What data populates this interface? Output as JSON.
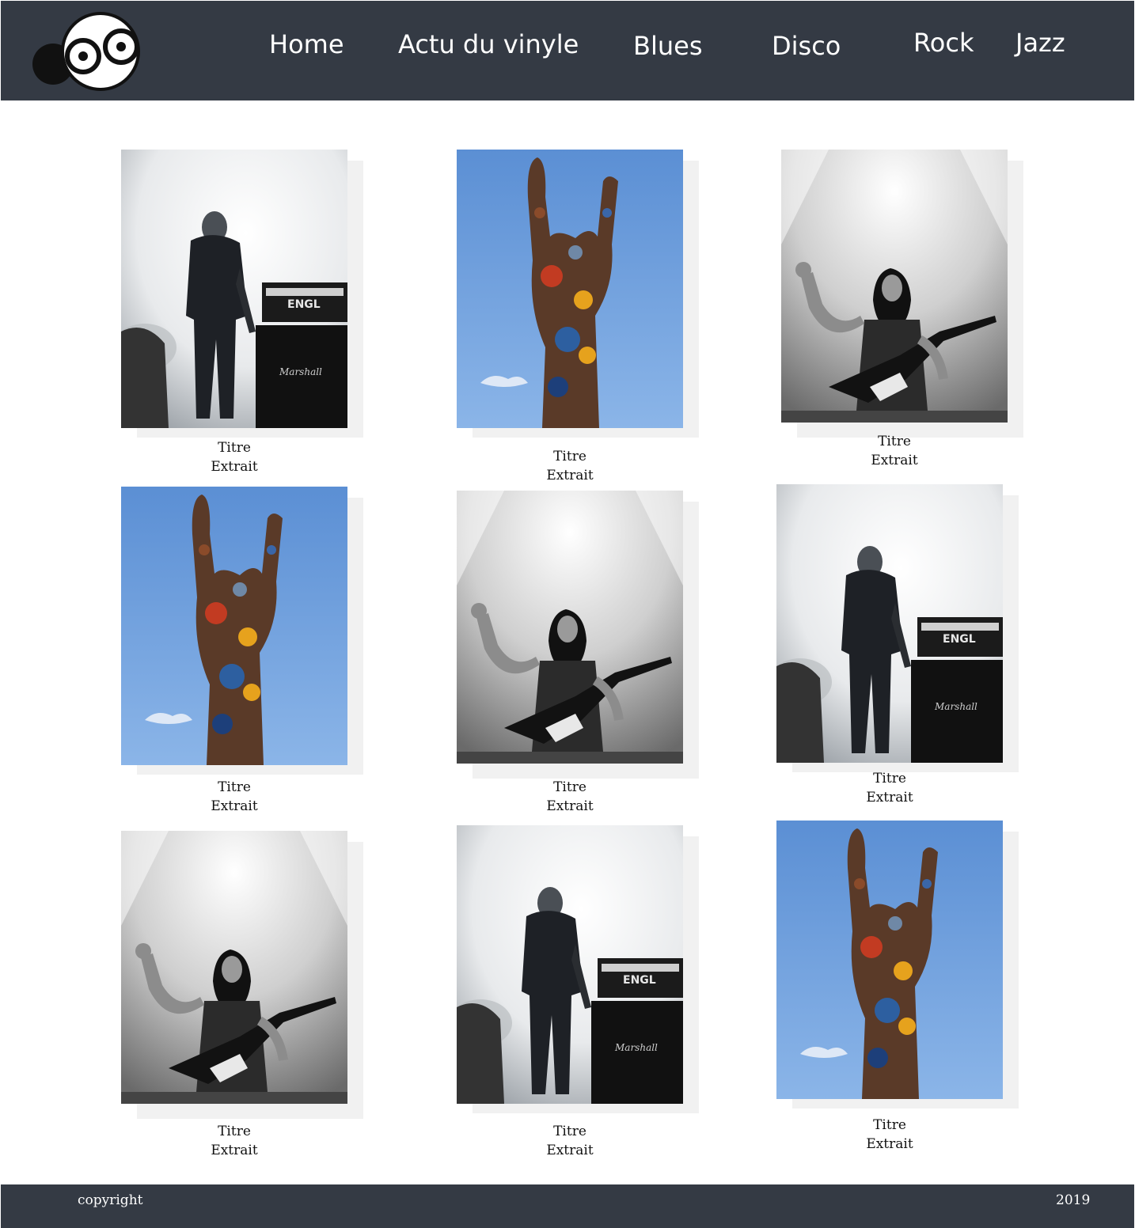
{
  "header": {
    "logo": {
      "icon": "googly-eyes-logo-icon"
    },
    "nav": [
      {
        "label": "Home"
      },
      {
        "label": "Actu du vinyle"
      },
      {
        "label": "Blues"
      },
      {
        "label": "Disco"
      },
      {
        "label": "Rock"
      },
      {
        "label": "Jazz"
      }
    ]
  },
  "gallery": [
    {
      "photo": "guitarist-silhouette-fog",
      "title": "Titre",
      "excerpt": "Extrait"
    },
    {
      "photo": "rock-hand-sculpture-sky",
      "title": "Titre",
      "excerpt": "Extrait"
    },
    {
      "photo": "singer-guitarist-stage-bw",
      "title": "Titre",
      "excerpt": "Extrait"
    },
    {
      "photo": "rock-hand-sculpture-sky",
      "title": "Titre",
      "excerpt": "Extrait"
    },
    {
      "photo": "singer-guitarist-stage-bw",
      "title": "Titre",
      "excerpt": "Extrait"
    },
    {
      "photo": "guitarist-silhouette-fog",
      "title": "Titre",
      "excerpt": "Extrait"
    },
    {
      "photo": "singer-guitarist-stage-bw",
      "title": "Titre",
      "excerpt": "Extrait"
    },
    {
      "photo": "guitarist-silhouette-fog",
      "title": "Titre",
      "excerpt": "Extrait"
    },
    {
      "photo": "rock-hand-sculpture-sky",
      "title": "Titre",
      "excerpt": "Extrait"
    }
  ],
  "footer": {
    "copyright": "copyright",
    "year": "2019"
  },
  "colors": {
    "bar": "#343a44",
    "sky": "#6a9ad6"
  }
}
